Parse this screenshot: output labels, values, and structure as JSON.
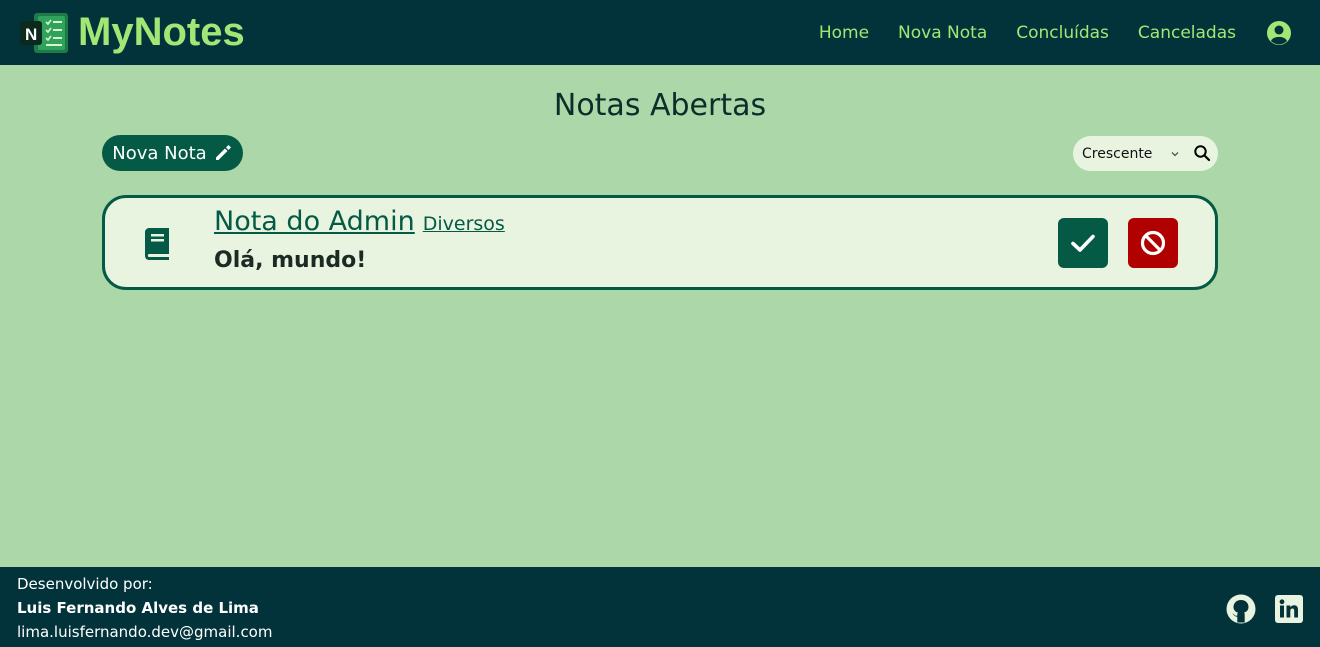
{
  "app": {
    "name": "MyNotes",
    "logo_letter": "N"
  },
  "nav": {
    "home": "Home",
    "new_note": "Nova Nota",
    "completed": "Concluídas",
    "canceled": "Canceladas"
  },
  "page": {
    "title": "Notas Abertas"
  },
  "toolbar": {
    "new_note_label": "Nova Nota",
    "sort_selected": "Crescente"
  },
  "notes": [
    {
      "title": "Nota do Admin",
      "category": "Diversos",
      "body": "Olá, mundo!"
    }
  ],
  "footer": {
    "developed_by": "Desenvolvido por:",
    "author": "Luis Fernando Alves de Lima",
    "email": "lima.luisfernando.dev@gmail.com"
  },
  "icons": {
    "logo": "notebook-checklist-icon",
    "user": "user-circle-icon",
    "edit": "pencil-icon",
    "sort": "chevron-down-icon",
    "search": "search-icon",
    "note": "book-icon",
    "complete": "check-icon",
    "cancel": "ban-icon",
    "social_github": "github-icon",
    "social_linkedin": "linkedin-icon"
  },
  "colors": {
    "navbar": "#02333a",
    "accent": "#a3e675",
    "background": "#acd7a9",
    "primary": "#045a44",
    "danger": "#b00000",
    "card": "#e8f4e0"
  }
}
